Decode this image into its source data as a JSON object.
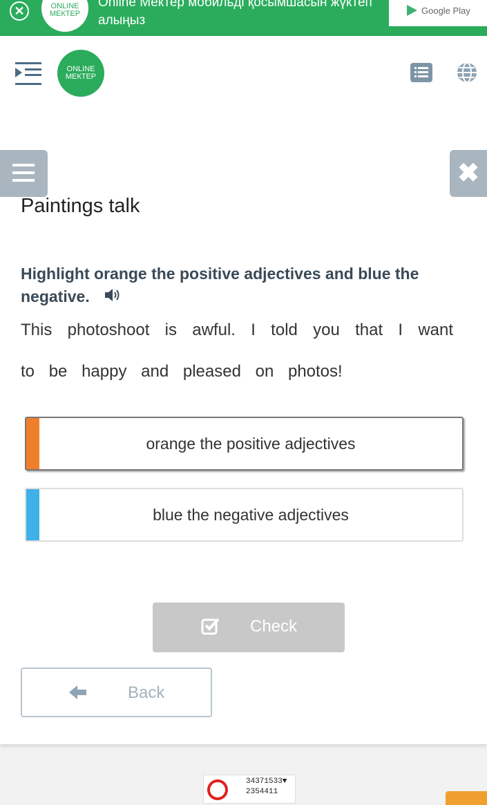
{
  "banner": {
    "close_icon": "close-circle-icon",
    "logo_text": "ONLINE МЕКТЕР",
    "text": "Online Мектер мобильді қосымшасын жүктеп алыңыз",
    "store_label": "Google Play",
    "color": "#2aac5c"
  },
  "header": {
    "logo_text": "ONLINE МЕКТЕР",
    "menu_icon": "menu-indent-icon",
    "list_icon": "list-icon",
    "globe_icon": "globe-icon"
  },
  "side": {
    "menu_icon": "hamburger-icon",
    "close_icon": "close-icon",
    "close_glyph": "✖"
  },
  "lesson": {
    "title": "Paintings talk",
    "instruction": "Highlight orange the positive adjectives and blue the negative.",
    "sentence_words": [
      "This",
      "photoshoot",
      "is",
      "awful.",
      "I",
      "told",
      "you",
      "that",
      "I",
      "want",
      "to",
      "be",
      "happy",
      "and",
      "pleased",
      "on",
      "photos!"
    ],
    "options": [
      {
        "label": "orange the positive adjectives",
        "color": "#f07f2b",
        "selected": true
      },
      {
        "label": "blue the negative adjectives",
        "color": "#3fb0e8",
        "selected": false
      }
    ],
    "check_label": "Check",
    "back_label": "Back"
  },
  "footer": {
    "counter_line1": "34371533▼",
    "counter_line2": "2354411"
  }
}
